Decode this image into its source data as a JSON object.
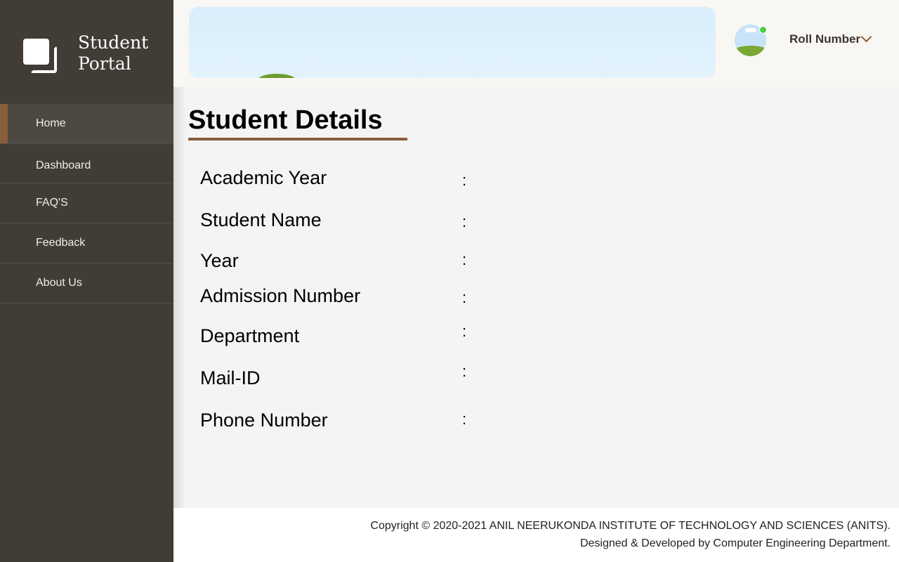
{
  "brand": {
    "line1": "Student",
    "line2": "Portal",
    "logo_icon": "stacked-squares-icon"
  },
  "sidebar": {
    "items": [
      {
        "label": "Home",
        "active": true
      },
      {
        "label": "Dashboard",
        "active": false
      },
      {
        "label": "FAQ'S",
        "active": false
      },
      {
        "label": "Feedback",
        "active": false
      },
      {
        "label": "About Us",
        "active": false
      }
    ]
  },
  "header": {
    "user_menu_label": "Roll Number",
    "chevron_icon": "chevron-down-icon",
    "status_color": "#4dcb4d"
  },
  "main": {
    "title": "Student Details",
    "fields": [
      {
        "label": "Academic Year",
        "value": ""
      },
      {
        "label": "Student Name",
        "value": ""
      },
      {
        "label": "Year",
        "value": ""
      },
      {
        "label": "Admission Number",
        "value": ""
      },
      {
        "label": "Department",
        "value": ""
      },
      {
        "label": "Mail-ID",
        "value": ""
      },
      {
        "label": "Phone Number",
        "value": ""
      }
    ],
    "separator": ":"
  },
  "footer": {
    "line1": "Copyright © 2020-2021 ANIL NEERUKONDA INSTITUTE OF TECHNOLOGY AND SCIENCES (ANITS).",
    "line2": "Designed & Developed by Computer Engineering Department."
  },
  "colors": {
    "sidebar_bg": "#423c36",
    "accent": "#8b5e3b",
    "page_bg": "#f5f4f2"
  }
}
